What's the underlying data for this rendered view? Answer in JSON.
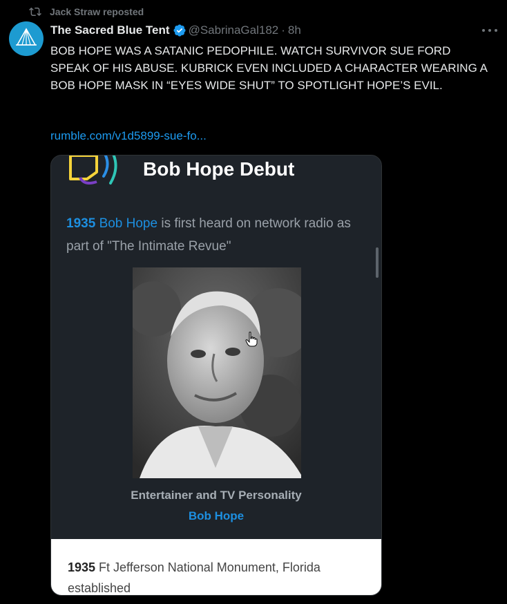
{
  "repost": {
    "icon": "repost-icon",
    "label": "Jack Straw reposted"
  },
  "author": {
    "display_name": "The Sacred Blue Tent",
    "verified_icon": "verified-badge-icon",
    "handle": "@SabrinaGal182",
    "separator": "·",
    "time": "8h",
    "avatar_icon": "tent-icon"
  },
  "tweet": {
    "text": "BOB HOPE WAS A SATANIC PEDOPHILE. WATCH SURVIVOR SUE FORD SPEAK OF HIS ABUSE. KUBRICK EVEN INCLUDED A CHARACTER WEARING A BOB HOPE MASK IN “EYES WIDE SHUT” TO SPOTLIGHT HOPE’S EVIL.",
    "link": "rumble.com/v1d5899-sue-fo..."
  },
  "card": {
    "title": "Bob Hope Debut",
    "desc_year": "1935",
    "desc_name": "Bob Hope",
    "desc_rest": " is first heard on network radio as part of \"The Intimate Revue\"",
    "role": "Entertainer and TV Personality",
    "person_name": "Bob Hope",
    "event_year": "1935",
    "event_text": " Ft Jefferson National Monument, Florida established"
  },
  "colors": {
    "accent": "#1d9bf0",
    "card_bg": "#1e2329",
    "link_blue": "#1d8fe0"
  }
}
